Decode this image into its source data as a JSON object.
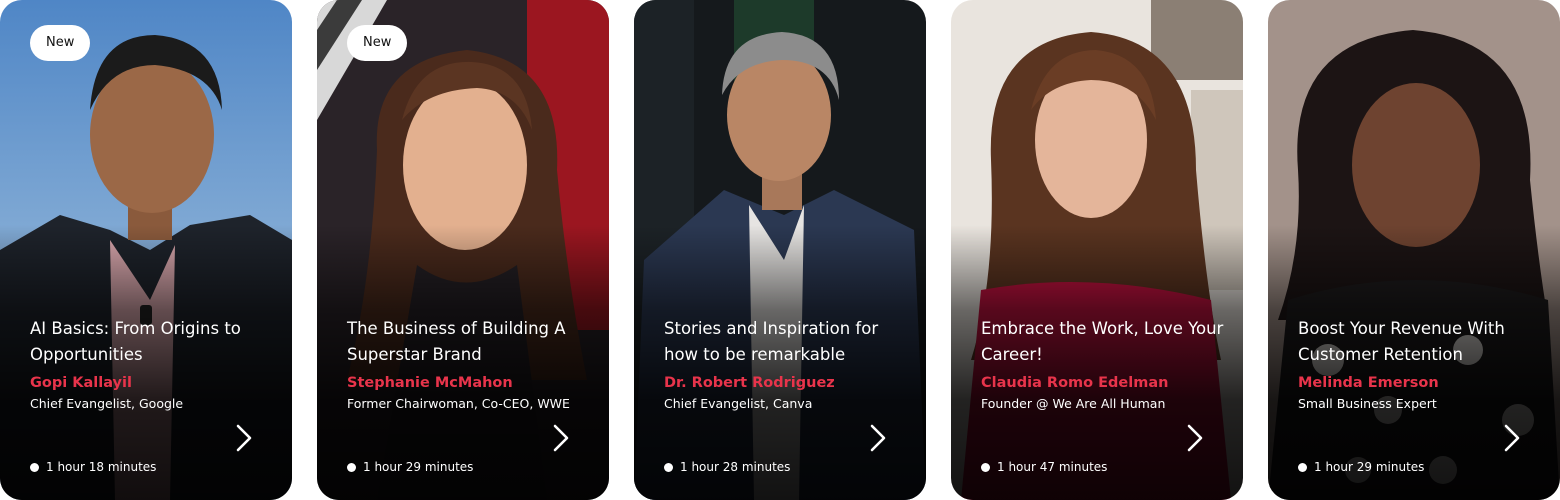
{
  "cards": [
    {
      "badge": "New",
      "title": "AI Basics: From Origins to Opportunities",
      "speaker": "Gopi Kallayil",
      "role": "Chief Evangelist, Google",
      "duration": "1 hour 18 minutes"
    },
    {
      "badge": "New",
      "title": "The Business of Building A Superstar Brand",
      "speaker": "Stephanie McMahon",
      "role": "Former Chairwoman, Co-CEO, WWE",
      "duration": "1 hour 29 minutes"
    },
    {
      "title": "Stories and Inspiration for how to be remarkable",
      "speaker": "Dr. Robert Rodriguez",
      "role": "Chief Evangelist, Canva",
      "duration": "1 hour 28 minutes"
    },
    {
      "title": "Embrace the Work, Love Your Career!",
      "speaker": "Claudia Romo Edelman",
      "role": "Founder @ We Are All Human",
      "duration": "1 hour 47 minutes"
    },
    {
      "title": "Boost Your Revenue With Customer Retention",
      "speaker": "Melinda Emerson",
      "role": "Small Business Expert",
      "duration": "1 hour 29 minutes"
    }
  ],
  "colors": {
    "speaker_accent": "#e8344b",
    "badge_bg": "#ffffff",
    "text": "#ffffff"
  },
  "icons": {
    "next": "chevron-right-icon",
    "duration": "dot-icon"
  }
}
